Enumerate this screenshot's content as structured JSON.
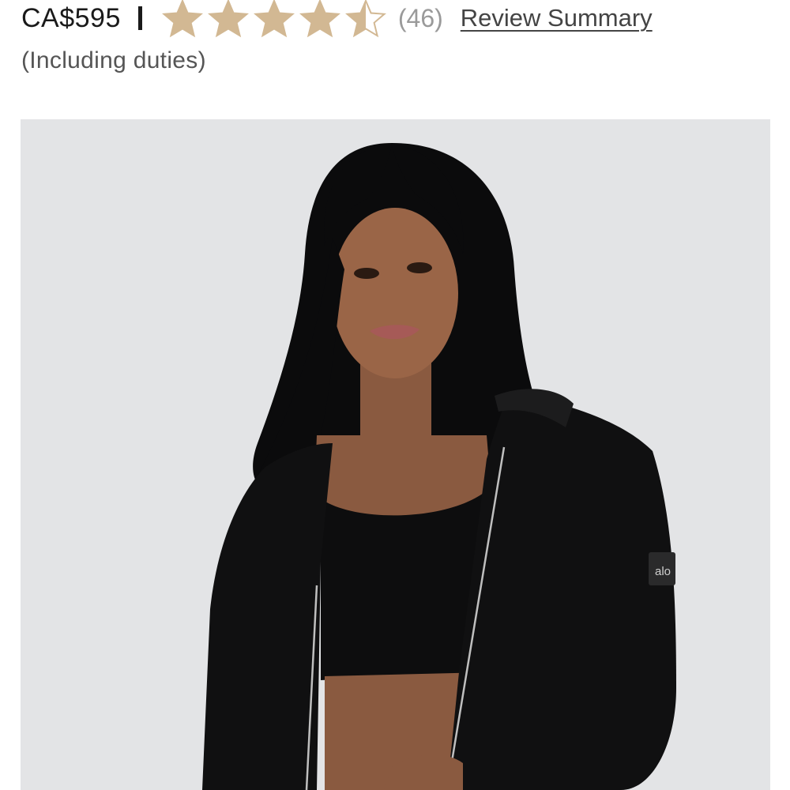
{
  "product": {
    "price": "CA$595",
    "separator": "|",
    "price_note": "(Including duties)"
  },
  "rating": {
    "value": 4.5,
    "max": 5,
    "count_text": "(46)",
    "review_summary_label": "Review Summary",
    "star_color": "#d2b893",
    "star_empty_color": "#ffffff"
  },
  "gallery": {
    "background_color": "#e3e4e6",
    "logo_text": "alo"
  }
}
